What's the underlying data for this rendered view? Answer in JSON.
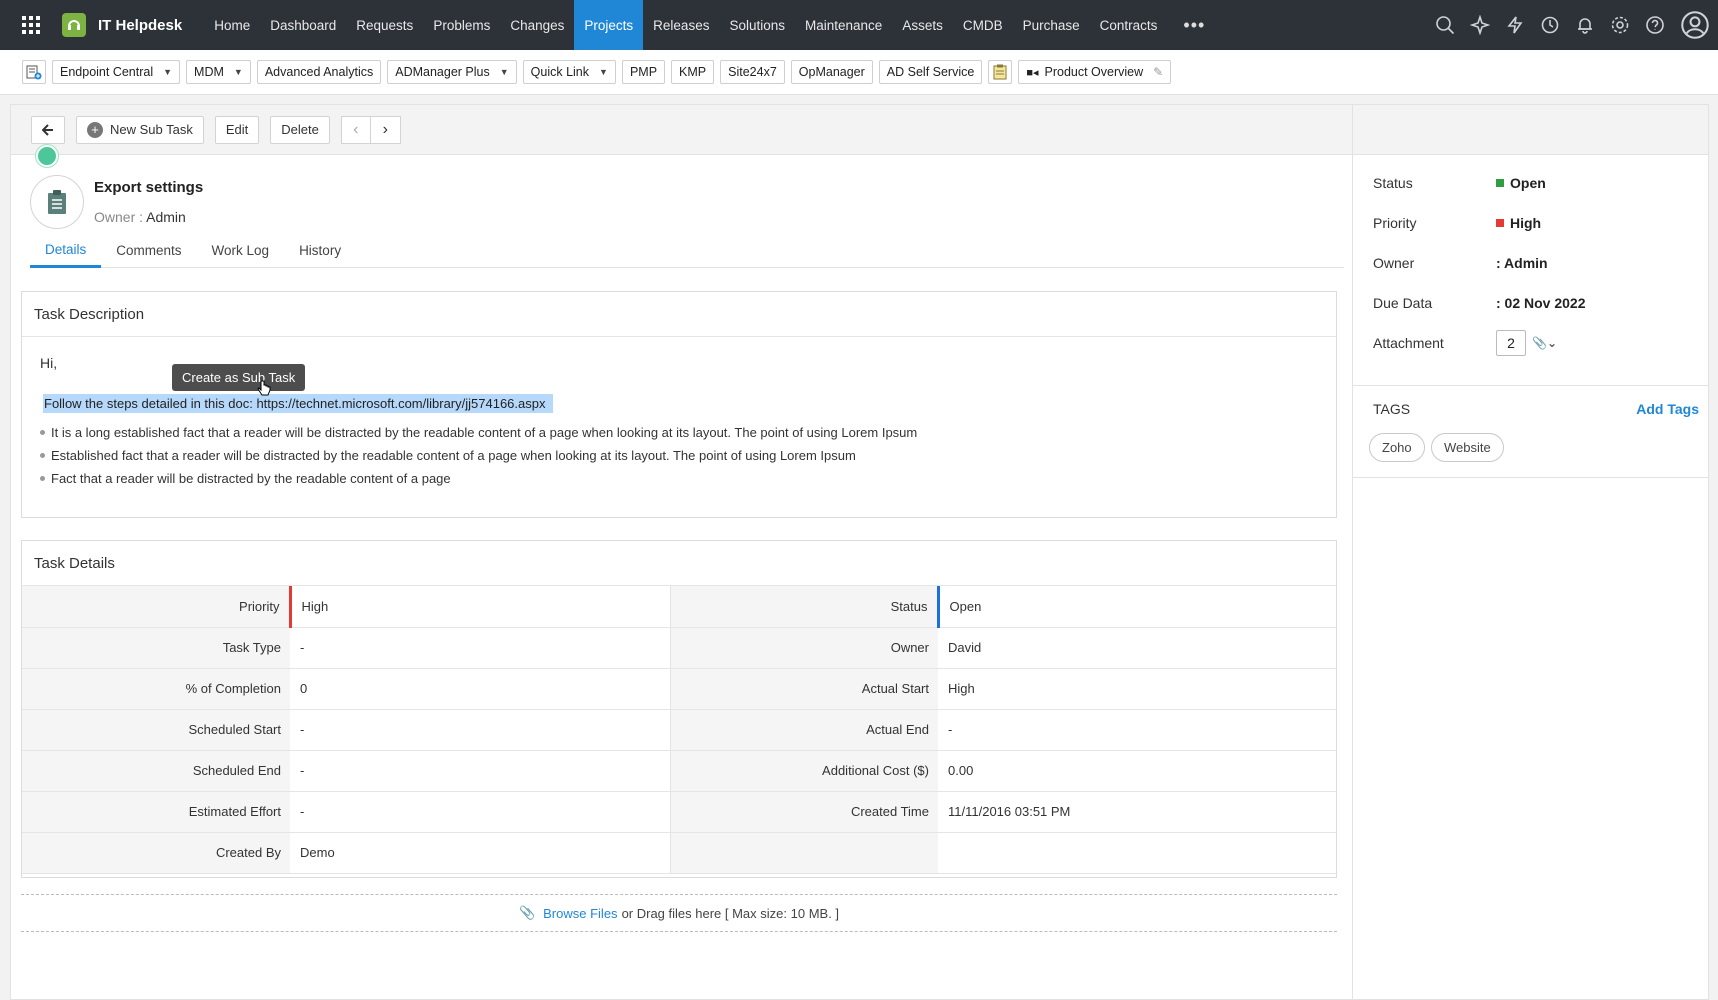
{
  "topbar": {
    "app_name": "IT Helpdesk",
    "nav": [
      "Home",
      "Dashboard",
      "Requests",
      "Problems",
      "Changes",
      "Projects",
      "Releases",
      "Solutions",
      "Maintenance",
      "Assets",
      "CMDB",
      "Purchase",
      "Contracts"
    ],
    "active_nav": "Projects",
    "more": "•••",
    "icons": [
      "search-icon",
      "sparkle-icon",
      "lightning-icon",
      "history-icon",
      "bell-icon",
      "settings-icon",
      "help-icon",
      "user-avatar-icon"
    ]
  },
  "quick_links": {
    "items": [
      {
        "label": "Endpoint Central",
        "dropdown": true
      },
      {
        "label": "MDM",
        "dropdown": true
      },
      {
        "label": "Advanced Analytics",
        "dropdown": false
      },
      {
        "label": "ADManager Plus",
        "dropdown": true
      },
      {
        "label": "Quick Link",
        "dropdown": true
      },
      {
        "label": "PMP",
        "dropdown": false
      },
      {
        "label": "KMP",
        "dropdown": false
      },
      {
        "label": "Site24x7",
        "dropdown": false
      },
      {
        "label": "OpManager",
        "dropdown": false
      },
      {
        "label": "AD Self Service",
        "dropdown": false
      }
    ],
    "product_overview": "Product Overview"
  },
  "toolbar": {
    "new_sub_task": "New Sub Task",
    "edit": "Edit",
    "delete": "Delete"
  },
  "task": {
    "title": "Export settings",
    "owner_label": "Owner : ",
    "owner_value": "Admin"
  },
  "tabs": [
    "Details",
    "Comments",
    "Work Log",
    "History"
  ],
  "active_tab": "Details",
  "description": {
    "title": "Task Description",
    "greeting": "Hi,",
    "highlighted": "Follow the steps detailed in this doc: https://technet.microsoft.com/library/jj574166.aspx",
    "tooltip": "Create as Sub Task",
    "bullets": [
      "It is a long established fact that a reader will be distracted by the readable content of a page when looking at its layout. The point of using Lorem Ipsum",
      "Established fact that a reader will be distracted by the readable content of a page when looking at its layout. The point of using Lorem Ipsum",
      "Fact that a reader will be distracted by the readable content of a page"
    ]
  },
  "details": {
    "title": "Task Details",
    "rows": [
      {
        "l1": "Priority",
        "v1": "High",
        "l2": "Status",
        "v2": "Open"
      },
      {
        "l1": "Task Type",
        "v1": "-",
        "l2": "Owner",
        "v2": "David"
      },
      {
        "l1": "% of Completion",
        "v1": "0",
        "l2": "Actual Start",
        "v2": "High"
      },
      {
        "l1": "Scheduled Start",
        "v1": "-",
        "l2": "Actual End",
        "v2": "-"
      },
      {
        "l1": "Scheduled End",
        "v1": "-",
        "l2": "Additional Cost ($)",
        "v2": "0.00"
      },
      {
        "l1": "Estimated Effort",
        "v1": "-",
        "l2": "Created Time",
        "v2": "11/11/2016 03:51 PM"
      },
      {
        "l1": "Created By",
        "v1": "Demo",
        "l2": "",
        "v2": ""
      }
    ]
  },
  "upload": {
    "browse": "Browse Files",
    "rest": "or Drag files here [ Max size: 10 MB. ]"
  },
  "side": {
    "status_label": "Status",
    "status_value": "Open",
    "status_color": "#2e9e3e",
    "priority_label": "Priority",
    "priority_value": "High",
    "priority_color": "#e53935",
    "owner_label": "Owner",
    "owner_value": ": Admin",
    "due_label": "Due Data",
    "due_value": ": 02 Nov 2022",
    "attachment_label": "Attachment",
    "attachment_count": "2",
    "tags_title": "TAGS",
    "add_tags": "Add Tags",
    "tags": [
      "Zoho",
      "Website"
    ]
  }
}
